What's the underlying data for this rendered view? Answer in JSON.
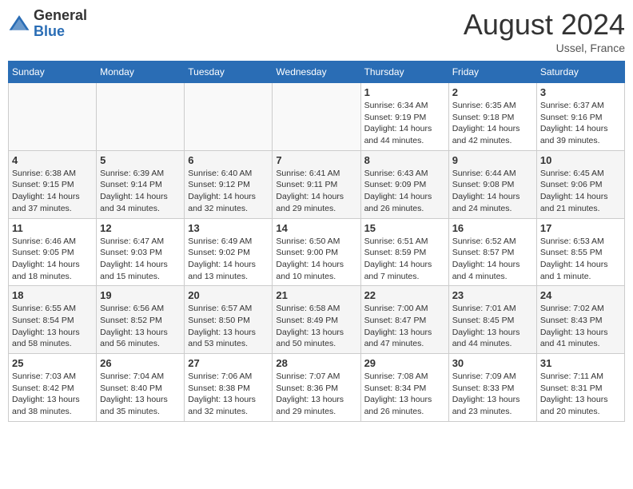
{
  "header": {
    "logo_general": "General",
    "logo_blue": "Blue",
    "month_title": "August 2024",
    "location": "Ussel, France"
  },
  "days_of_week": [
    "Sunday",
    "Monday",
    "Tuesday",
    "Wednesday",
    "Thursday",
    "Friday",
    "Saturday"
  ],
  "weeks": [
    [
      {
        "day": "",
        "info": ""
      },
      {
        "day": "",
        "info": ""
      },
      {
        "day": "",
        "info": ""
      },
      {
        "day": "",
        "info": ""
      },
      {
        "day": "1",
        "info": "Sunrise: 6:34 AM\nSunset: 9:19 PM\nDaylight: 14 hours\nand 44 minutes."
      },
      {
        "day": "2",
        "info": "Sunrise: 6:35 AM\nSunset: 9:18 PM\nDaylight: 14 hours\nand 42 minutes."
      },
      {
        "day": "3",
        "info": "Sunrise: 6:37 AM\nSunset: 9:16 PM\nDaylight: 14 hours\nand 39 minutes."
      }
    ],
    [
      {
        "day": "4",
        "info": "Sunrise: 6:38 AM\nSunset: 9:15 PM\nDaylight: 14 hours\nand 37 minutes."
      },
      {
        "day": "5",
        "info": "Sunrise: 6:39 AM\nSunset: 9:14 PM\nDaylight: 14 hours\nand 34 minutes."
      },
      {
        "day": "6",
        "info": "Sunrise: 6:40 AM\nSunset: 9:12 PM\nDaylight: 14 hours\nand 32 minutes."
      },
      {
        "day": "7",
        "info": "Sunrise: 6:41 AM\nSunset: 9:11 PM\nDaylight: 14 hours\nand 29 minutes."
      },
      {
        "day": "8",
        "info": "Sunrise: 6:43 AM\nSunset: 9:09 PM\nDaylight: 14 hours\nand 26 minutes."
      },
      {
        "day": "9",
        "info": "Sunrise: 6:44 AM\nSunset: 9:08 PM\nDaylight: 14 hours\nand 24 minutes."
      },
      {
        "day": "10",
        "info": "Sunrise: 6:45 AM\nSunset: 9:06 PM\nDaylight: 14 hours\nand 21 minutes."
      }
    ],
    [
      {
        "day": "11",
        "info": "Sunrise: 6:46 AM\nSunset: 9:05 PM\nDaylight: 14 hours\nand 18 minutes."
      },
      {
        "day": "12",
        "info": "Sunrise: 6:47 AM\nSunset: 9:03 PM\nDaylight: 14 hours\nand 15 minutes."
      },
      {
        "day": "13",
        "info": "Sunrise: 6:49 AM\nSunset: 9:02 PM\nDaylight: 14 hours\nand 13 minutes."
      },
      {
        "day": "14",
        "info": "Sunrise: 6:50 AM\nSunset: 9:00 PM\nDaylight: 14 hours\nand 10 minutes."
      },
      {
        "day": "15",
        "info": "Sunrise: 6:51 AM\nSunset: 8:59 PM\nDaylight: 14 hours\nand 7 minutes."
      },
      {
        "day": "16",
        "info": "Sunrise: 6:52 AM\nSunset: 8:57 PM\nDaylight: 14 hours\nand 4 minutes."
      },
      {
        "day": "17",
        "info": "Sunrise: 6:53 AM\nSunset: 8:55 PM\nDaylight: 14 hours\nand 1 minute."
      }
    ],
    [
      {
        "day": "18",
        "info": "Sunrise: 6:55 AM\nSunset: 8:54 PM\nDaylight: 13 hours\nand 58 minutes."
      },
      {
        "day": "19",
        "info": "Sunrise: 6:56 AM\nSunset: 8:52 PM\nDaylight: 13 hours\nand 56 minutes."
      },
      {
        "day": "20",
        "info": "Sunrise: 6:57 AM\nSunset: 8:50 PM\nDaylight: 13 hours\nand 53 minutes."
      },
      {
        "day": "21",
        "info": "Sunrise: 6:58 AM\nSunset: 8:49 PM\nDaylight: 13 hours\nand 50 minutes."
      },
      {
        "day": "22",
        "info": "Sunrise: 7:00 AM\nSunset: 8:47 PM\nDaylight: 13 hours\nand 47 minutes."
      },
      {
        "day": "23",
        "info": "Sunrise: 7:01 AM\nSunset: 8:45 PM\nDaylight: 13 hours\nand 44 minutes."
      },
      {
        "day": "24",
        "info": "Sunrise: 7:02 AM\nSunset: 8:43 PM\nDaylight: 13 hours\nand 41 minutes."
      }
    ],
    [
      {
        "day": "25",
        "info": "Sunrise: 7:03 AM\nSunset: 8:42 PM\nDaylight: 13 hours\nand 38 minutes."
      },
      {
        "day": "26",
        "info": "Sunrise: 7:04 AM\nSunset: 8:40 PM\nDaylight: 13 hours\nand 35 minutes."
      },
      {
        "day": "27",
        "info": "Sunrise: 7:06 AM\nSunset: 8:38 PM\nDaylight: 13 hours\nand 32 minutes."
      },
      {
        "day": "28",
        "info": "Sunrise: 7:07 AM\nSunset: 8:36 PM\nDaylight: 13 hours\nand 29 minutes."
      },
      {
        "day": "29",
        "info": "Sunrise: 7:08 AM\nSunset: 8:34 PM\nDaylight: 13 hours\nand 26 minutes."
      },
      {
        "day": "30",
        "info": "Sunrise: 7:09 AM\nSunset: 8:33 PM\nDaylight: 13 hours\nand 23 minutes."
      },
      {
        "day": "31",
        "info": "Sunrise: 7:11 AM\nSunset: 8:31 PM\nDaylight: 13 hours\nand 20 minutes."
      }
    ]
  ]
}
